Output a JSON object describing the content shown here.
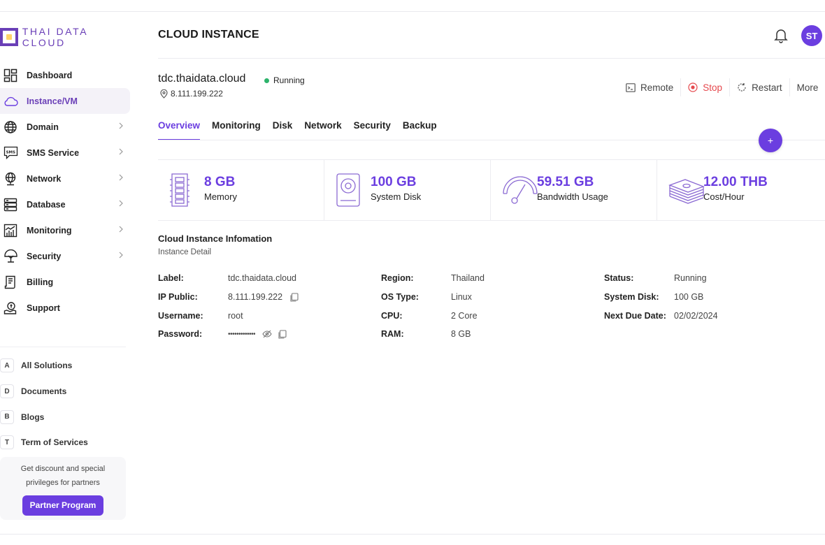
{
  "brand": {
    "name": "THAI DATA CLOUD",
    "accent": "#6b3ee0"
  },
  "sidebar": {
    "items": [
      {
        "label": "Dashboard",
        "icon": "dashboard-icon",
        "chevron": false
      },
      {
        "label": "Instance/VM",
        "icon": "cloud-icon",
        "chevron": false,
        "active": true
      },
      {
        "label": "Domain",
        "icon": "globe-icon",
        "chevron": true
      },
      {
        "label": "SMS Service",
        "icon": "sms-icon",
        "chevron": true
      },
      {
        "label": "Network",
        "icon": "network-icon",
        "chevron": true
      },
      {
        "label": "Database",
        "icon": "database-icon",
        "chevron": true
      },
      {
        "label": "Monitoring",
        "icon": "monitoring-icon",
        "chevron": true
      },
      {
        "label": "Security",
        "icon": "shield-icon",
        "chevron": true
      },
      {
        "label": "Billing",
        "icon": "billing-icon",
        "chevron": false
      },
      {
        "label": "Support",
        "icon": "support-icon",
        "chevron": false
      }
    ],
    "links": [
      {
        "badge": "A",
        "label": "All Solutions"
      },
      {
        "badge": "D",
        "label": "Documents"
      },
      {
        "badge": "B",
        "label": "Blogs"
      },
      {
        "badge": "T",
        "label": "Term of Services"
      }
    ],
    "promo": {
      "text": "Get discount and special privileges for partners",
      "button": "Partner Program"
    }
  },
  "header": {
    "title": "CLOUD INSTANCE",
    "avatar_initials": "ST"
  },
  "instance": {
    "name": "tdc.thaidata.cloud",
    "status": "Running",
    "status_color": "#2db36b",
    "ip": "8.111.199.222"
  },
  "actions": {
    "remote": "Remote",
    "stop": "Stop",
    "restart": "Restart",
    "more": "More"
  },
  "tabs": [
    "Overview",
    "Monitoring",
    "Disk",
    "Network",
    "Security",
    "Backup"
  ],
  "fab_label": "+",
  "stats": [
    {
      "value": "8 GB",
      "label": "Memory",
      "icon": "memory-icon"
    },
    {
      "value": "100 GB",
      "label": "System Disk",
      "icon": "disk-icon"
    },
    {
      "value": "59.51 GB",
      "label": "Bandwidth Usage",
      "icon": "gauge-icon"
    },
    {
      "value": "12.00 THB",
      "label": "Cost/Hour",
      "icon": "money-icon"
    }
  ],
  "info": {
    "title": "Cloud Instance Infomation",
    "subtitle": "Instance Detail",
    "col1": [
      {
        "key": "Label:",
        "value": "tdc.thaidata.cloud"
      },
      {
        "key": "IP Public:",
        "value": "8.111.199.222"
      },
      {
        "key": "Username:",
        "value": "root"
      },
      {
        "key": "Password:",
        "value": "•••••••••••••"
      }
    ],
    "col2": [
      {
        "key": "Region:",
        "value": "Thailand"
      },
      {
        "key": "OS Type:",
        "value": "Linux"
      },
      {
        "key": "CPU:",
        "value": "2 Core"
      },
      {
        "key": "RAM:",
        "value": "8 GB"
      }
    ],
    "col3": [
      {
        "key": "Status:",
        "value": "Running"
      },
      {
        "key": "System Disk:",
        "value": "100 GB"
      },
      {
        "key": "Next Due Date:",
        "value": "02/02/2024"
      }
    ]
  }
}
